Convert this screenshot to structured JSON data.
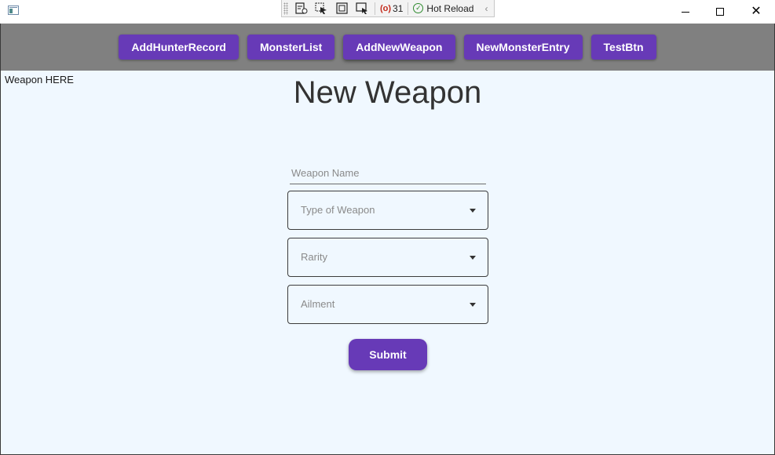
{
  "devtools": {
    "error_count": "31",
    "hot_reload_label": "Hot Reload"
  },
  "nav": {
    "buttons": [
      {
        "label": "AddHunterRecord"
      },
      {
        "label": "MonsterList"
      },
      {
        "label": "AddNewWeapon"
      },
      {
        "label": "NewMonsterEntry"
      },
      {
        "label": "TestBtn"
      }
    ]
  },
  "page": {
    "corner_label": "Weapon HERE",
    "title": "New Weapon"
  },
  "form": {
    "weapon_name_placeholder": "Weapon Name",
    "weapon_name_value": "",
    "type_placeholder": "Type of Weapon",
    "rarity_placeholder": "Rarity",
    "ailment_placeholder": "Ailment",
    "submit_label": "Submit"
  },
  "colors": {
    "accent": "#673ab7",
    "navbar_bg": "#808080",
    "content_bg": "#f0f8ff"
  }
}
